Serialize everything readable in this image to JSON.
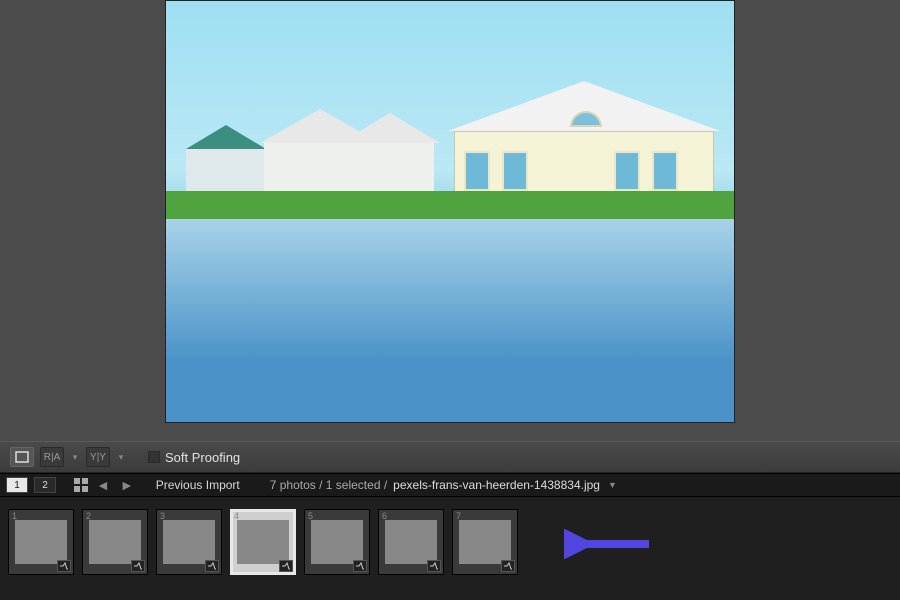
{
  "toolbar": {
    "view_loupe": "☐",
    "compare_ra": "R|A",
    "compare_yy": "Y|Y",
    "soft_proofing_label": "Soft Proofing",
    "soft_proofing_checked": false
  },
  "filmstrip_header": {
    "monitor_1": "1",
    "monitor_2": "2",
    "source_label": "Previous Import",
    "count_text": "7 photos / 1 selected /",
    "filename": "pexels-frans-van-heerden-1438834.jpg"
  },
  "thumbnails": [
    {
      "index": "1",
      "scene": "sc-room",
      "selected": false,
      "badge": true
    },
    {
      "index": "2",
      "scene": "sc-dark",
      "selected": false,
      "badge": true
    },
    {
      "index": "3",
      "scene": "sc-room",
      "selected": false,
      "badge": true
    },
    {
      "index": "4",
      "scene": "sc-lake",
      "selected": true,
      "badge": true
    },
    {
      "index": "5",
      "scene": "sc-white",
      "selected": false,
      "badge": true
    },
    {
      "index": "6",
      "scene": "sc-kitchen",
      "selected": false,
      "badge": true
    },
    {
      "index": "7",
      "scene": "sc-store",
      "selected": false,
      "badge": true
    }
  ],
  "annotation": {
    "arrow_color": "#5245e0"
  }
}
